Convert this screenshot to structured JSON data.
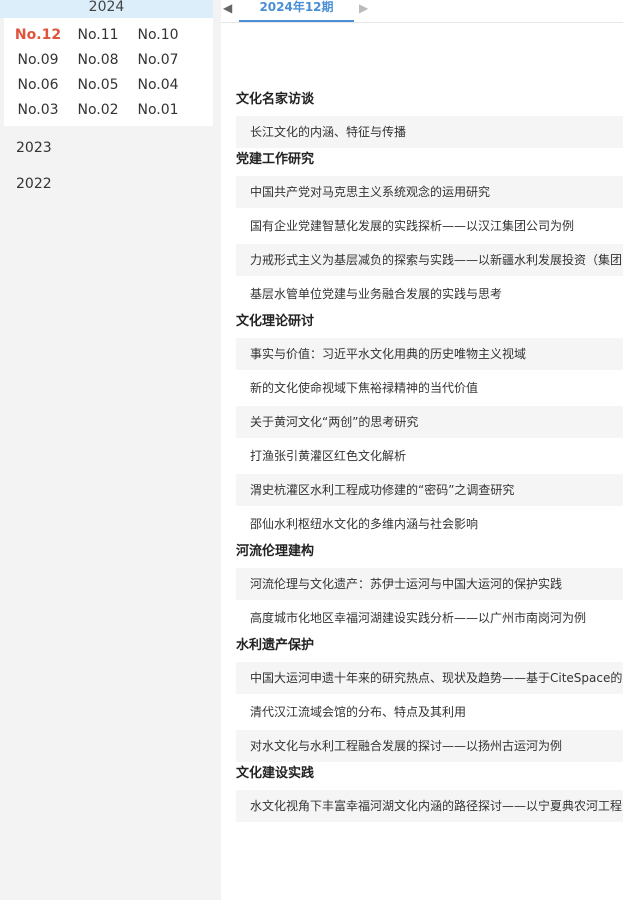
{
  "sidebar": {
    "current_year": "2024",
    "issue_rows": [
      [
        "No.12",
        "No.11",
        "No.10"
      ],
      [
        "No.09",
        "No.08",
        "No.07"
      ],
      [
        "No.06",
        "No.05",
        "No.04"
      ],
      [
        "No.03",
        "No.02",
        "No.01"
      ]
    ],
    "active_issue": "No.12",
    "years": [
      "2023",
      "2022"
    ]
  },
  "topbar": {
    "prev_icon": "left-triangle",
    "next_icon": "right-triangle",
    "tab_label": "2024年12期"
  },
  "sections": [
    {
      "title": "文化名家访谈",
      "articles": [
        "长江文化的内涵、特征与传播"
      ]
    },
    {
      "title": "党建工作研究",
      "articles": [
        "中国共产党对马克思主义系统观念的运用研究",
        "国有企业党建智慧化发展的实践探析——以汉江集团公司为例",
        "力戒形式主义为基层减负的探索与实践——以新疆水利发展投资（集团",
        "基层水管单位党建与业务融合发展的实践与思考"
      ]
    },
    {
      "title": "文化理论研讨",
      "articles": [
        "事实与价值：习近平水文化用典的历史唯物主义视域",
        "新的文化使命视域下焦裕禄精神的当代价值",
        "关于黄河文化“两创”的思考研究",
        "打渔张引黄灌区红色文化解析",
        "渭史杭灌区水利工程成功修建的“密码”之调查研究",
        "邵仙水利枢纽水文化的多维内涵与社会影响"
      ]
    },
    {
      "title": "河流伦理建构",
      "articles": [
        "河流伦理与文化遗产：苏伊士运河与中国大运河的保护实践",
        "高度城市化地区幸福河湖建设实践分析——以广州市南岗河为例"
      ]
    },
    {
      "title": "水利遗产保护",
      "articles": [
        "中国大运河申遗十年来的研究热点、现状及趋势——基于CiteSpace的",
        "清代汉江流域会馆的分布、特点及其利用",
        "对水文化与水利工程融合发展的探讨——以扬州古运河为例"
      ]
    },
    {
      "title": "文化建设实践",
      "articles": [
        "水文化视角下丰富幸福河湖文化内涵的路径探讨——以宁夏典农河工程"
      ]
    }
  ]
}
